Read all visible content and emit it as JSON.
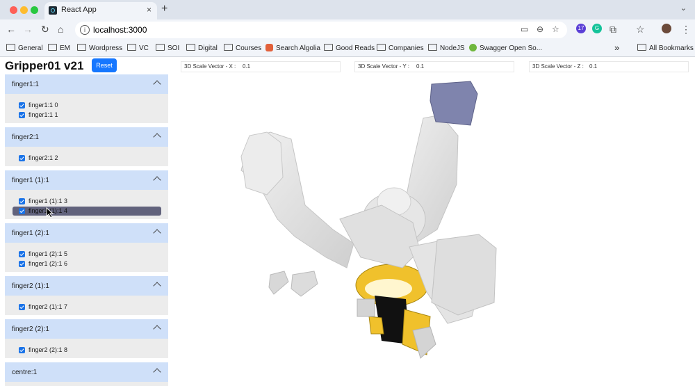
{
  "browser": {
    "tab_title": "React App",
    "tab_close": "×",
    "new_tab": "+",
    "url": "localhost:3000",
    "extension_badge": "17",
    "avatar": "",
    "bookmarks": [
      "General",
      "EM",
      "Wordpress",
      "VC",
      "SOI",
      "Digital",
      "Courses",
      "Search Algolia",
      "Good Reads",
      "Companies",
      "NodeJS",
      "Swagger Open So..."
    ],
    "overflow": "»",
    "all_bookmarks": "All Bookmarks"
  },
  "app": {
    "title": "Gripper01 v21",
    "reset_label": "Reset"
  },
  "sections": [
    {
      "title": "finger1:1",
      "items": [
        "finger1:1 0",
        "finger1:1 1"
      ]
    },
    {
      "title": "finger2:1",
      "items": [
        "finger2:1 2"
      ]
    },
    {
      "title": "finger1 (1):1",
      "items": [
        "finger1 (1):1 3",
        "finger1 (1):1 4"
      ]
    },
    {
      "title": "finger1 (2):1",
      "items": [
        "finger1 (2):1 5",
        "finger1 (2):1 6"
      ]
    },
    {
      "title": "finger2 (1):1",
      "items": [
        "finger2 (1):1 7"
      ]
    },
    {
      "title": "finger2 (2):1",
      "items": [
        "finger2 (2):1 8"
      ]
    },
    {
      "title": "centre:1",
      "items": []
    }
  ],
  "scale_vectors": [
    {
      "label": "3D Scale Vector - X :",
      "value": "0.1"
    },
    {
      "label": "3D Scale Vector - Y :",
      "value": "0.1"
    },
    {
      "label": "3D Scale Vector - Z :",
      "value": "0.1"
    }
  ],
  "colors": {
    "accent": "#1677ff",
    "section_header": "#cfe0f9",
    "selected_row": "#61627c",
    "model_gray": "#e3e3e3",
    "model_blue": "#7f84ad",
    "model_yellow": "#f0c12c"
  }
}
